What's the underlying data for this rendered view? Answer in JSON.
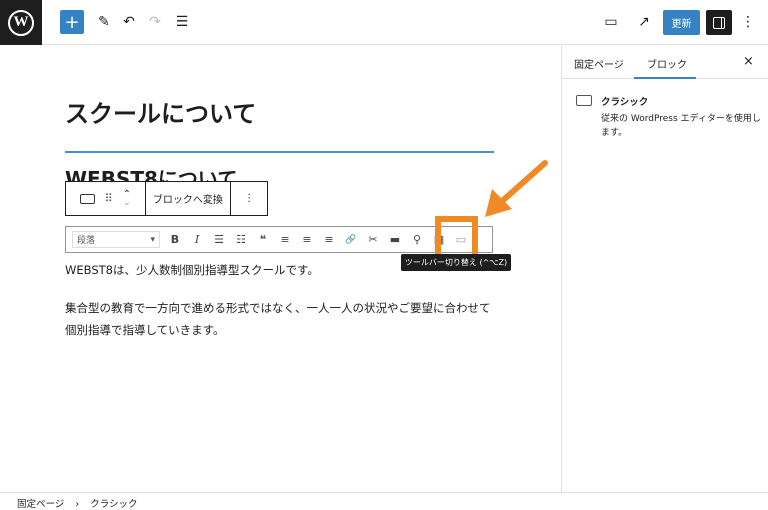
{
  "topbar": {
    "logo": "W",
    "add": "+",
    "edit": "✎",
    "undo": "↶",
    "redo": "↷",
    "list": "☰",
    "view": "▭",
    "external": "↗",
    "update": "更新",
    "more": "⋮"
  },
  "sidebar": {
    "tabs": [
      "固定ページ",
      "ブロック"
    ],
    "active_tab": 1,
    "close": "×",
    "block_name": "クラシック",
    "block_desc": "従来の WordPress エディターを使用します。"
  },
  "content": {
    "title": "スクールについて",
    "heading": "WEBST8について",
    "paragraphs": [
      "WEBST8は、少人数制個別指導型スクールです。",
      "集合型の教育で一方向で進める形式ではなく、一人一人の状況やご要望に合わせて個別指導で指導していきます。"
    ]
  },
  "block_toolbar": {
    "transform": "ブロックへ変換",
    "more": "⋮"
  },
  "format_toolbar": {
    "format_select": "段落",
    "buttons": [
      "B",
      "I",
      "☰",
      "☷",
      "❝",
      "≡",
      "≡",
      "≡",
      "🔗",
      "✂",
      "▬",
      "⚲",
      "▦",
      "▭"
    ]
  },
  "tooltip": "ツールバー切り替え (^⌥Z)",
  "accent_color": "#f08a24",
  "footer": {
    "breadcrumb": [
      "固定ページ",
      "クラシック"
    ],
    "separator": "›"
  }
}
